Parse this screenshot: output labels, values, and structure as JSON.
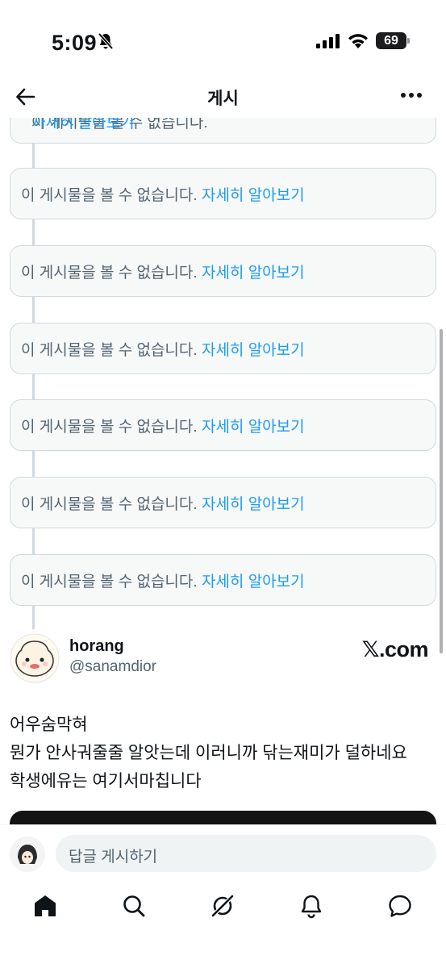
{
  "status_bar": {
    "time": "5:09",
    "battery": "69"
  },
  "header": {
    "title": "게시"
  },
  "thread": {
    "partial_card_text": "이 게시물을 볼 수 없습니다.",
    "partial_card_link": "자세히 알아보기",
    "unavailable_cards": [
      {
        "text": "이 게시물을 볼 수 없습니다.",
        "link": "자세히 알아보기"
      },
      {
        "text": "이 게시물을 볼 수 없습니다.",
        "link": "자세히 알아보기"
      },
      {
        "text": "이 게시물을 볼 수 없습니다.",
        "link": "자세히 알아보기"
      },
      {
        "text": "이 게시물을 볼 수 없습니다.",
        "link": "자세히 알아보기"
      },
      {
        "text": "이 게시물을 볼 수 없습니다.",
        "link": "자세히 알아보기"
      },
      {
        "text": "이 게시물을 볼 수 없습니다.",
        "link": "자세히 알아보기"
      }
    ]
  },
  "post": {
    "display_name": "horang",
    "handle": "@sanamdior",
    "source": "𝕏.com",
    "lines": [
      "어우숨막혀",
      "뭔가 안사궈줄줄 알앗는데 이러니까 닦는재미가 덜하네요",
      "학생에유는 여기서마칩니다"
    ]
  },
  "reply": {
    "placeholder": "답글 게시하기"
  },
  "icons": {
    "back": "arrow-left-icon",
    "more": "more-horizontal-icon",
    "home": "home-icon",
    "search": "search-icon",
    "grok": "grok-icon",
    "notifications": "bell-icon",
    "messages": "message-icon"
  },
  "colors": {
    "link": "#1d9bf0",
    "muted": "#536471",
    "card_bg": "#f7f9f9",
    "border": "#cfd9de"
  }
}
